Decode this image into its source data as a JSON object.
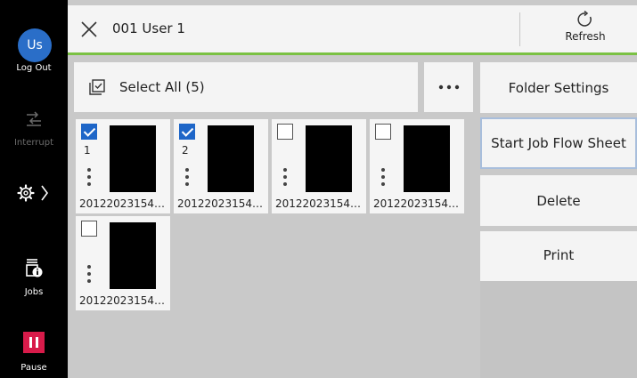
{
  "user": {
    "initials": "Us",
    "logout_label": "Log Out"
  },
  "rail": {
    "interrupt_label": "Interrupt",
    "jobs_label": "Jobs",
    "pause_label": "Pause"
  },
  "header": {
    "title": "001 User 1",
    "refresh_label": "Refresh"
  },
  "toolbar": {
    "select_all_label": "Select All (5)"
  },
  "files": [
    {
      "checked": true,
      "number": "1",
      "name": "20122023154…"
    },
    {
      "checked": true,
      "number": "2",
      "name": "20122023154…"
    },
    {
      "checked": false,
      "number": "",
      "name": "20122023154…"
    },
    {
      "checked": false,
      "number": "",
      "name": "20122023154…"
    },
    {
      "checked": false,
      "number": "",
      "name": "20122023154…"
    }
  ],
  "actions": {
    "folder_settings": "Folder Settings",
    "start_job_flow": "Start Job Flow Sheet",
    "delete": "Delete",
    "print": "Print"
  },
  "colors": {
    "accent": "#7ac143",
    "avatar": "#2a6ec8",
    "checkbox": "#1e66c8",
    "pause": "#d81b4a"
  },
  "icons": [
    "close-icon",
    "refresh-icon",
    "select-all-icon",
    "more-icon",
    "interrupt-icon",
    "settings-icon",
    "jobs-icon",
    "pause-icon"
  ]
}
